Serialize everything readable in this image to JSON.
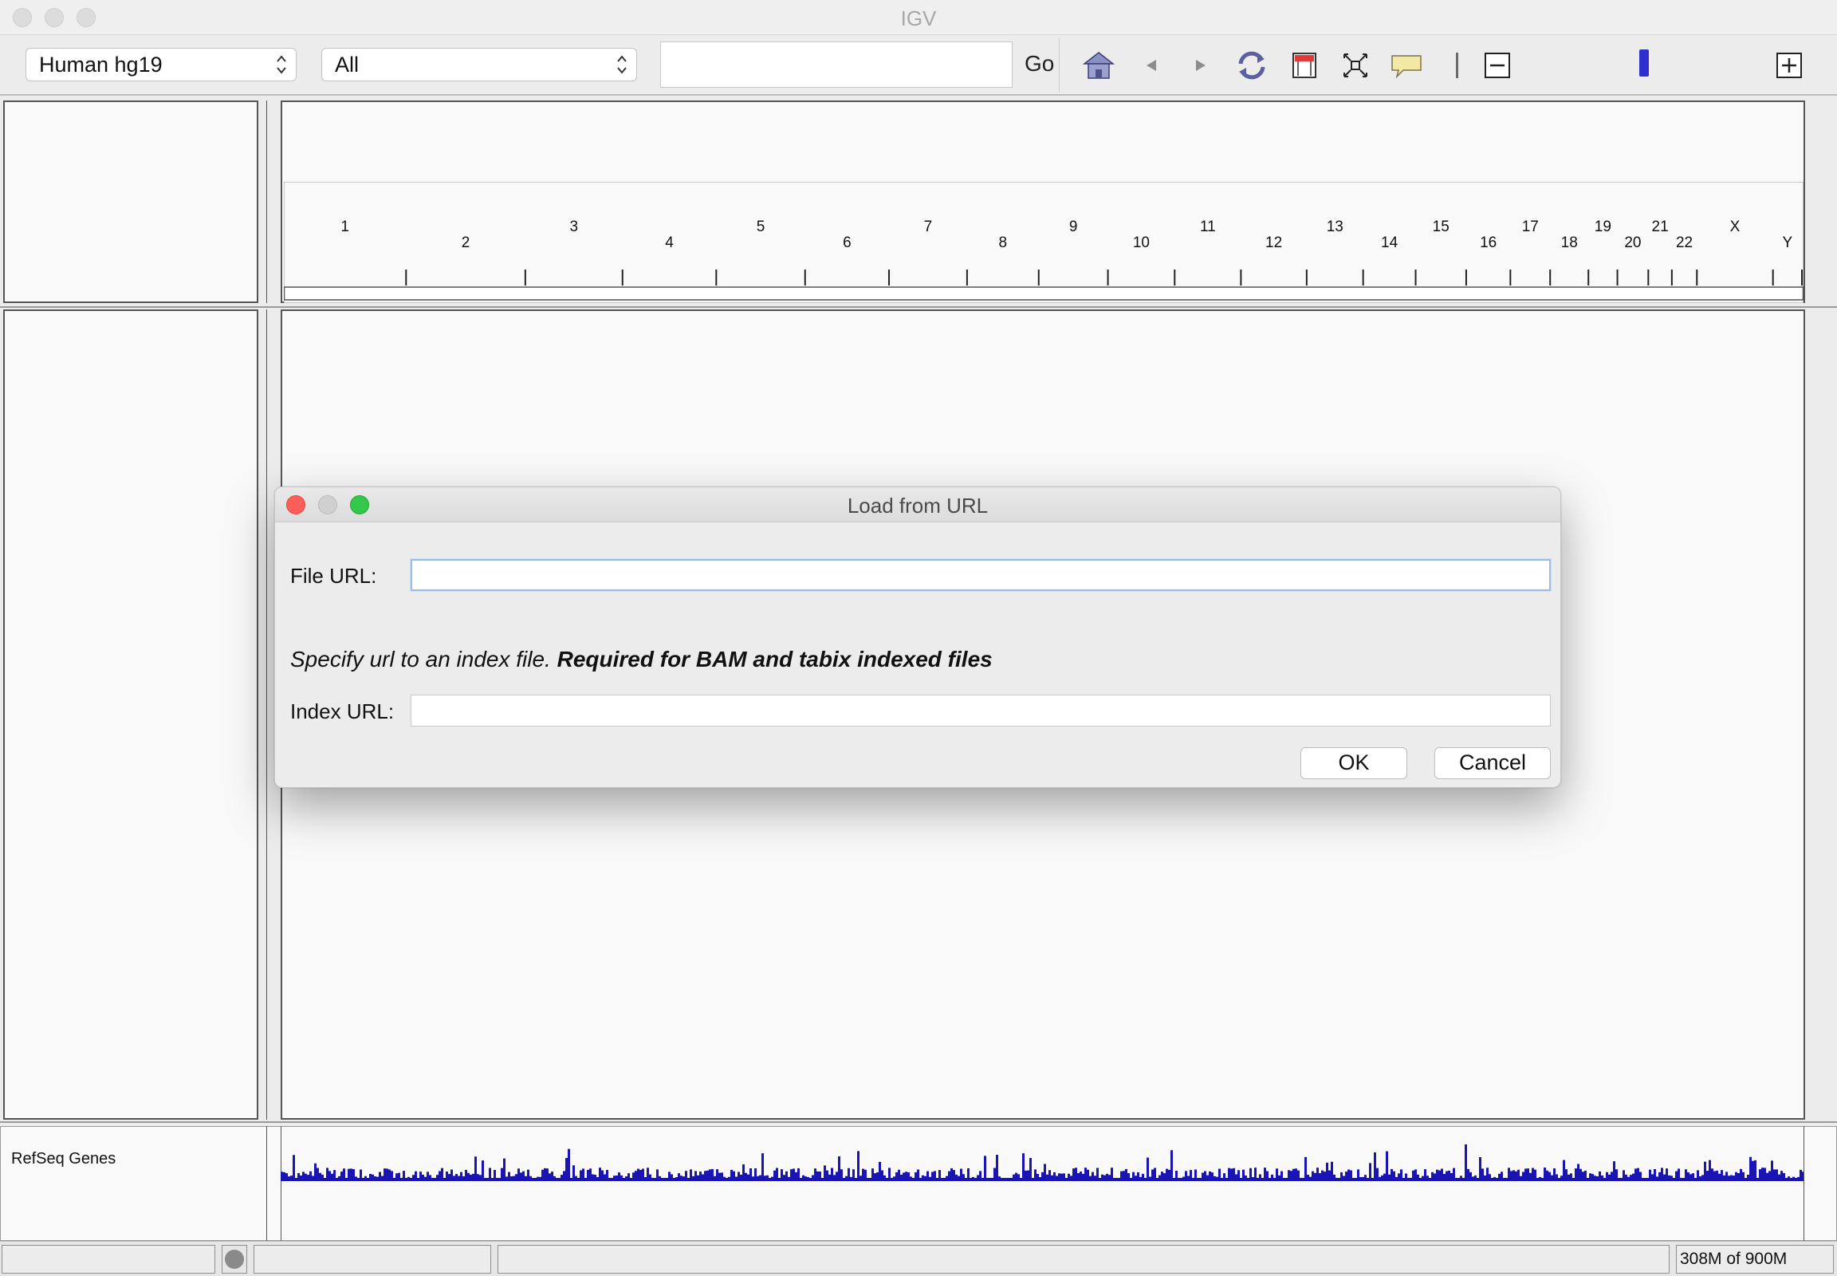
{
  "window": {
    "title": "IGV"
  },
  "toolbar": {
    "genome": "Human hg19",
    "chromosome": "All",
    "locus_value": "",
    "go_label": "Go",
    "icons": [
      "home-icon",
      "back-arrow-icon",
      "forward-arrow-icon",
      "refresh-icon",
      "region-of-interest-icon",
      "resize-to-window-icon",
      "popup-text-icon",
      "zoom-out-icon",
      "zoom-in-icon"
    ]
  },
  "ideogram": {
    "chromosomes": [
      "1",
      "2",
      "3",
      "4",
      "5",
      "6",
      "7",
      "8",
      "9",
      "10",
      "11",
      "12",
      "13",
      "14",
      "15",
      "16",
      "17",
      "18",
      "19",
      "20",
      "21",
      "22",
      "X",
      "Y"
    ]
  },
  "tracks": [
    {
      "name": "RefSeq Genes"
    }
  ],
  "status": {
    "memory": "308M of 900M"
  },
  "dialog": {
    "title": "Load from URL",
    "file_url_label": "File URL:",
    "file_url_value": "",
    "hint_italic": "Specify url to an index file.",
    "hint_bold": "Required for BAM and tabix indexed files",
    "index_url_label": "Index URL:",
    "index_url_value": "",
    "ok_label": "OK",
    "cancel_label": "Cancel"
  },
  "colors": {
    "gene_density": "#1a14b4",
    "focus_ring": "#9dbbe6",
    "zoom_slider": "#2f2fd0"
  }
}
